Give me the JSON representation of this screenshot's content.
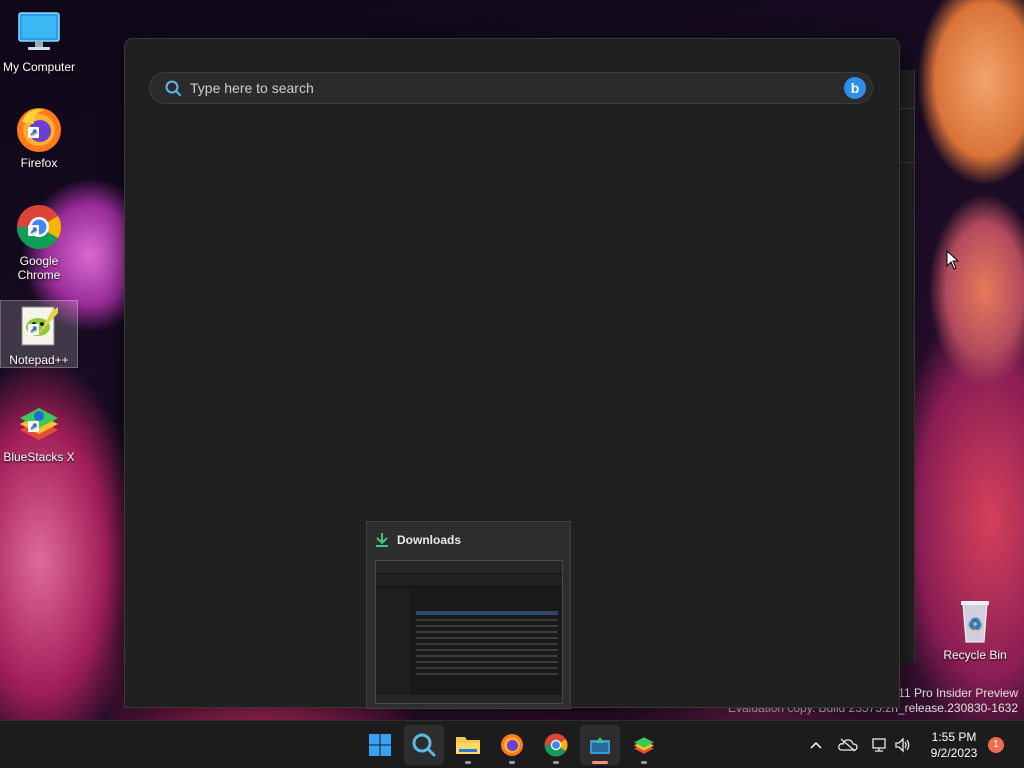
{
  "desktop": {
    "icons": [
      {
        "label": "My Computer"
      },
      {
        "label": "Firefox"
      },
      {
        "label": "Google Chrome"
      },
      {
        "label": "Notepad++"
      },
      {
        "label": "BlueStacks X"
      },
      {
        "label": "Recycle Bin"
      }
    ],
    "watermark": {
      "line1": "s 11 Pro Insider Preview",
      "line2": "Evaluation copy. Build 23575.zn_release.230830-1632"
    }
  },
  "search": {
    "placeholder": "Type here to search",
    "bing_glyph": "b"
  },
  "downloads_preview": {
    "title": "Downloads"
  },
  "taskbar": {
    "apps": [
      {
        "name": "start",
        "icon": "windows-logo-icon"
      },
      {
        "name": "search",
        "icon": "search-icon"
      },
      {
        "name": "file-explorer",
        "icon": "folder-icon"
      },
      {
        "name": "firefox",
        "icon": "firefox-icon"
      },
      {
        "name": "chrome",
        "icon": "chrome-icon"
      },
      {
        "name": "downloads-app",
        "icon": "app-window-icon"
      },
      {
        "name": "bluestacks",
        "icon": "bluestacks-icon"
      }
    ],
    "clock": {
      "time": "1:55 PM",
      "date": "9/2/2023"
    },
    "notification_count": "1"
  },
  "colors": {
    "accent": "#2f8fe8",
    "panel": "#202020",
    "taskbar": "#1c1c1c",
    "badge": "#f06a50"
  }
}
